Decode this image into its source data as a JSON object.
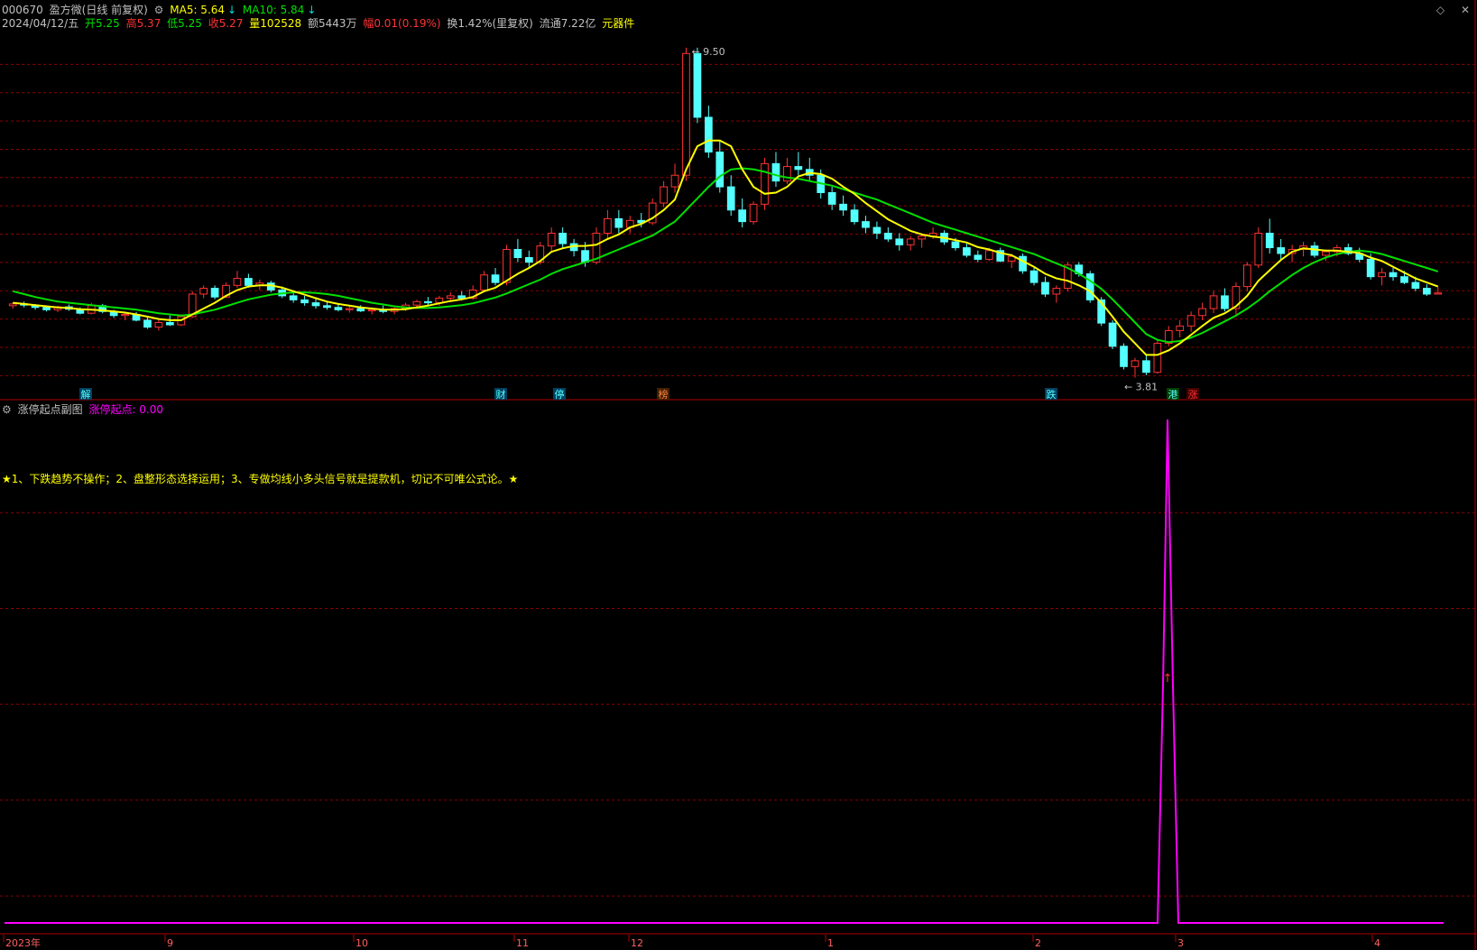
{
  "header": {
    "code": "000670",
    "name": "盈方微(日线 前复权)",
    "ma5_label": "MA5: 5.64",
    "ma10_label": "MA10: 5.84",
    "arrow_down": "↓"
  },
  "quote": {
    "date": "2024/04/12/五",
    "open": "开5.25",
    "high": "高5.37",
    "low": "低5.25",
    "close": "收5.27",
    "volume": "量102528",
    "amount": "额5443万",
    "change_label": "幅0.01",
    "change_pct": "(0.19%)",
    "turnover": "换1.42%(里复权)",
    "float_cap": "流通7.22亿",
    "unit": "元器件"
  },
  "colors": {
    "up": "#ff3232",
    "down": "#54ffff",
    "ma5": "#ffff00",
    "ma10": "#00e000",
    "grid": "#8b0000",
    "indicator": "#ff00ff",
    "text": "#c0c0c0"
  },
  "markers": {
    "high_label": "9.50",
    "low_label": "3.81"
  },
  "events": [
    {
      "label": "解",
      "month": "2023-08"
    },
    {
      "label": "财",
      "month": "2023-10"
    },
    {
      "label": "停",
      "month": "2023-11"
    },
    {
      "label": "榜",
      "month": "2023-11"
    },
    {
      "label": "跌",
      "month": "2024-02"
    },
    {
      "label": "港",
      "month": "2024-03"
    },
    {
      "label": "涨",
      "month": "2024-03"
    }
  ],
  "indicator": {
    "title": "涨停起点副图",
    "value_label": "涨停起点: 0.00",
    "note": "★1、下跌趋势不操作；2、盘整形态选择运用；3、专做均线小多头信号就是提款机，切记不可唯公式论。★"
  },
  "xaxis": {
    "labels": [
      "2023年",
      "9",
      "10",
      "11",
      "12",
      "1",
      "2",
      "3",
      "4"
    ]
  },
  "chart_data": {
    "type": "candlestick",
    "ylim": [
      3.6,
      9.7
    ],
    "series_names": [
      "MA5",
      "MA10"
    ],
    "candles": [
      [
        5.05,
        5.1,
        5.0,
        5.08
      ],
      [
        5.08,
        5.12,
        5.02,
        5.06
      ],
      [
        5.06,
        5.08,
        4.98,
        5.02
      ],
      [
        5.02,
        5.05,
        4.95,
        4.98
      ],
      [
        4.98,
        5.05,
        4.94,
        5.03
      ],
      [
        5.03,
        5.07,
        4.96,
        4.99
      ],
      [
        4.99,
        5.02,
        4.9,
        4.92
      ],
      [
        4.92,
        5.1,
        4.9,
        5.05
      ],
      [
        5.05,
        5.08,
        4.92,
        4.95
      ],
      [
        4.95,
        4.98,
        4.84,
        4.88
      ],
      [
        4.88,
        4.94,
        4.8,
        4.9
      ],
      [
        4.9,
        4.94,
        4.78,
        4.8
      ],
      [
        4.8,
        4.85,
        4.65,
        4.68
      ],
      [
        4.68,
        4.8,
        4.62,
        4.76
      ],
      [
        4.76,
        4.88,
        4.7,
        4.72
      ],
      [
        4.72,
        4.9,
        4.7,
        4.86
      ],
      [
        4.86,
        5.3,
        4.84,
        5.25
      ],
      [
        5.25,
        5.4,
        5.18,
        5.35
      ],
      [
        5.35,
        5.4,
        5.16,
        5.2
      ],
      [
        5.2,
        5.45,
        5.18,
        5.4
      ],
      [
        5.4,
        5.65,
        5.36,
        5.52
      ],
      [
        5.52,
        5.6,
        5.36,
        5.4
      ],
      [
        5.4,
        5.5,
        5.32,
        5.44
      ],
      [
        5.44,
        5.48,
        5.28,
        5.32
      ],
      [
        5.32,
        5.38,
        5.18,
        5.22
      ],
      [
        5.22,
        5.3,
        5.1,
        5.15
      ],
      [
        5.15,
        5.22,
        5.05,
        5.1
      ],
      [
        5.1,
        5.18,
        5.0,
        5.05
      ],
      [
        5.05,
        5.12,
        4.98,
        5.02
      ],
      [
        5.02,
        5.08,
        4.95,
        4.98
      ],
      [
        4.98,
        5.05,
        4.93,
        5.0
      ],
      [
        5.0,
        5.06,
        4.94,
        4.96
      ],
      [
        4.96,
        5.02,
        4.9,
        4.98
      ],
      [
        4.98,
        5.05,
        4.92,
        4.95
      ],
      [
        4.95,
        5.02,
        4.9,
        5.0
      ],
      [
        5.0,
        5.1,
        4.96,
        5.06
      ],
      [
        5.06,
        5.15,
        5.02,
        5.12
      ],
      [
        5.12,
        5.2,
        5.06,
        5.1
      ],
      [
        5.1,
        5.22,
        5.05,
        5.18
      ],
      [
        5.18,
        5.28,
        5.12,
        5.22
      ],
      [
        5.22,
        5.3,
        5.14,
        5.18
      ],
      [
        5.18,
        5.4,
        5.15,
        5.32
      ],
      [
        5.32,
        5.65,
        5.28,
        5.58
      ],
      [
        5.58,
        5.7,
        5.4,
        5.45
      ],
      [
        5.45,
        6.1,
        5.4,
        6.02
      ],
      [
        6.02,
        6.2,
        5.8,
        5.88
      ],
      [
        5.88,
        6.0,
        5.72,
        5.8
      ],
      [
        5.8,
        6.15,
        5.76,
        6.08
      ],
      [
        6.08,
        6.4,
        6.0,
        6.3
      ],
      [
        6.3,
        6.4,
        6.05,
        6.12
      ],
      [
        6.12,
        6.2,
        5.9,
        6.0
      ],
      [
        6.0,
        6.15,
        5.72,
        5.8
      ],
      [
        5.8,
        6.4,
        5.76,
        6.3
      ],
      [
        6.3,
        6.7,
        6.2,
        6.55
      ],
      [
        6.55,
        6.7,
        6.3,
        6.4
      ],
      [
        6.4,
        6.6,
        6.3,
        6.52
      ],
      [
        6.52,
        6.65,
        6.4,
        6.48
      ],
      [
        6.48,
        6.9,
        6.44,
        6.82
      ],
      [
        6.82,
        7.2,
        6.75,
        7.1
      ],
      [
        7.1,
        7.5,
        7.0,
        7.3
      ],
      [
        7.3,
        9.5,
        7.2,
        9.4
      ],
      [
        9.4,
        9.5,
        8.2,
        8.3
      ],
      [
        8.3,
        8.5,
        7.6,
        7.7
      ],
      [
        7.7,
        7.9,
        7.0,
        7.1
      ],
      [
        7.1,
        7.3,
        6.6,
        6.7
      ],
      [
        6.7,
        6.9,
        6.4,
        6.5
      ],
      [
        6.5,
        6.85,
        6.45,
        6.8
      ],
      [
        6.8,
        7.6,
        6.7,
        7.5
      ],
      [
        7.5,
        7.7,
        7.1,
        7.2
      ],
      [
        7.2,
        7.6,
        7.15,
        7.45
      ],
      [
        7.45,
        7.7,
        7.3,
        7.4
      ],
      [
        7.4,
        7.6,
        7.2,
        7.3
      ],
      [
        7.3,
        7.4,
        6.9,
        7.0
      ],
      [
        7.0,
        7.1,
        6.7,
        6.8
      ],
      [
        6.8,
        6.95,
        6.6,
        6.7
      ],
      [
        6.7,
        6.8,
        6.45,
        6.5
      ],
      [
        6.5,
        6.6,
        6.3,
        6.4
      ],
      [
        6.4,
        6.5,
        6.2,
        6.3
      ],
      [
        6.3,
        6.4,
        6.15,
        6.2
      ],
      [
        6.2,
        6.3,
        6.0,
        6.1
      ],
      [
        6.1,
        6.25,
        6.0,
        6.2
      ],
      [
        6.2,
        6.3,
        6.05,
        6.25
      ],
      [
        6.25,
        6.4,
        6.2,
        6.3
      ],
      [
        6.3,
        6.35,
        6.1,
        6.15
      ],
      [
        6.15,
        6.22,
        6.0,
        6.05
      ],
      [
        6.05,
        6.12,
        5.88,
        5.92
      ],
      [
        5.92,
        6.0,
        5.8,
        5.85
      ],
      [
        5.85,
        6.05,
        5.82,
        6.0
      ],
      [
        6.0,
        6.05,
        5.8,
        5.82
      ],
      [
        5.82,
        5.95,
        5.7,
        5.9
      ],
      [
        5.9,
        5.95,
        5.6,
        5.65
      ],
      [
        5.65,
        5.7,
        5.4,
        5.45
      ],
      [
        5.45,
        5.55,
        5.2,
        5.25
      ],
      [
        5.25,
        5.4,
        5.1,
        5.35
      ],
      [
        5.35,
        5.8,
        5.3,
        5.75
      ],
      [
        5.75,
        5.8,
        5.55,
        5.6
      ],
      [
        5.6,
        5.65,
        5.1,
        5.15
      ],
      [
        5.15,
        5.2,
        4.7,
        4.75
      ],
      [
        4.75,
        4.8,
        4.3,
        4.35
      ],
      [
        4.35,
        4.4,
        3.95,
        4.0
      ],
      [
        4.0,
        4.15,
        3.81,
        4.1
      ],
      [
        4.1,
        4.2,
        3.85,
        3.9
      ],
      [
        3.9,
        4.45,
        3.88,
        4.4
      ],
      [
        4.4,
        4.7,
        4.35,
        4.62
      ],
      [
        4.62,
        4.8,
        4.5,
        4.7
      ],
      [
        4.7,
        4.95,
        4.6,
        4.88
      ],
      [
        4.88,
        5.1,
        4.8,
        5.0
      ],
      [
        5.0,
        5.3,
        4.92,
        5.22
      ],
      [
        5.22,
        5.35,
        4.95,
        5.0
      ],
      [
        5.0,
        5.45,
        4.9,
        5.38
      ],
      [
        5.38,
        5.8,
        5.3,
        5.75
      ],
      [
        5.75,
        6.4,
        5.7,
        6.3
      ],
      [
        6.3,
        6.55,
        5.95,
        6.05
      ],
      [
        6.05,
        6.2,
        5.85,
        5.95
      ],
      [
        5.95,
        6.1,
        5.8,
        6.02
      ],
      [
        6.02,
        6.15,
        5.9,
        6.08
      ],
      [
        6.08,
        6.15,
        5.88,
        5.92
      ],
      [
        5.92,
        6.02,
        5.82,
        5.98
      ],
      [
        5.98,
        6.1,
        5.9,
        6.05
      ],
      [
        6.05,
        6.12,
        5.92,
        5.95
      ],
      [
        5.95,
        6.05,
        5.8,
        5.85
      ],
      [
        5.85,
        5.95,
        5.5,
        5.55
      ],
      [
        5.55,
        5.7,
        5.4,
        5.62
      ],
      [
        5.62,
        5.7,
        5.48,
        5.55
      ],
      [
        5.55,
        5.65,
        5.42,
        5.45
      ],
      [
        5.45,
        5.55,
        5.3,
        5.35
      ],
      [
        5.35,
        5.42,
        5.22,
        5.25
      ],
      [
        5.25,
        5.37,
        5.25,
        5.27
      ]
    ],
    "ma5": [
      5.1,
      5.08,
      5.06,
      5.04,
      5.02,
      5.01,
      4.99,
      4.98,
      4.97,
      4.95,
      4.93,
      4.9,
      4.86,
      4.82,
      4.8,
      4.8,
      4.9,
      5.0,
      5.1,
      5.22,
      5.32,
      5.38,
      5.4,
      5.4,
      5.36,
      5.3,
      5.24,
      5.18,
      5.12,
      5.08,
      5.05,
      5.02,
      5.0,
      4.98,
      4.98,
      4.99,
      5.02,
      5.05,
      5.09,
      5.13,
      5.16,
      5.2,
      5.3,
      5.36,
      5.48,
      5.6,
      5.7,
      5.82,
      5.98,
      6.04,
      6.08,
      6.08,
      6.1,
      6.2,
      6.28,
      6.4,
      6.46,
      6.56,
      6.7,
      6.88,
      7.4,
      7.8,
      7.9,
      7.9,
      7.8,
      7.4,
      7.1,
      6.98,
      7.0,
      7.1,
      7.28,
      7.34,
      7.32,
      7.24,
      7.1,
      6.98,
      6.82,
      6.68,
      6.54,
      6.44,
      6.34,
      6.28,
      6.24,
      6.22,
      6.18,
      6.14,
      6.06,
      6.02,
      5.96,
      5.92,
      5.82,
      5.72,
      5.6,
      5.52,
      5.48,
      5.4,
      5.3,
      5.1,
      4.86,
      4.6,
      4.4,
      4.2,
      4.2,
      4.28,
      4.4,
      4.55,
      4.7,
      4.84,
      4.92,
      5.04,
      5.22,
      5.48,
      5.66,
      5.84,
      5.98,
      6.04,
      6.02,
      6.0,
      6.0,
      5.98,
      5.96,
      5.88,
      5.82,
      5.72,
      5.62,
      5.52,
      5.45,
      5.38
    ],
    "ma10": [
      5.3,
      5.25,
      5.2,
      5.16,
      5.12,
      5.1,
      5.08,
      5.06,
      5.04,
      5.02,
      5.0,
      4.98,
      4.95,
      4.92,
      4.9,
      4.88,
      4.9,
      4.94,
      4.98,
      5.04,
      5.1,
      5.16,
      5.2,
      5.24,
      5.26,
      5.28,
      5.28,
      5.27,
      5.25,
      5.22,
      5.18,
      5.14,
      5.1,
      5.07,
      5.04,
      5.02,
      5.01,
      5.01,
      5.02,
      5.04,
      5.06,
      5.09,
      5.14,
      5.19,
      5.26,
      5.34,
      5.42,
      5.5,
      5.6,
      5.68,
      5.74,
      5.8,
      5.86,
      5.94,
      6.02,
      6.1,
      6.18,
      6.26,
      6.38,
      6.5,
      6.7,
      6.9,
      7.1,
      7.28,
      7.4,
      7.42,
      7.4,
      7.36,
      7.3,
      7.26,
      7.24,
      7.2,
      7.16,
      7.12,
      7.06,
      7.0,
      6.94,
      6.88,
      6.8,
      6.72,
      6.64,
      6.56,
      6.48,
      6.42,
      6.36,
      6.3,
      6.24,
      6.18,
      6.12,
      6.06,
      6.0,
      5.94,
      5.86,
      5.78,
      5.7,
      5.6,
      5.48,
      5.34,
      5.16,
      4.96,
      4.76,
      4.56,
      4.46,
      4.42,
      4.44,
      4.5,
      4.58,
      4.68,
      4.78,
      4.88,
      5.0,
      5.14,
      5.3,
      5.44,
      5.58,
      5.7,
      5.8,
      5.88,
      5.94,
      5.98,
      6.0,
      5.98,
      5.94,
      5.88,
      5.82,
      5.76,
      5.7,
      5.64
    ],
    "indicator_values": {
      "spike_value": 1,
      "baseline": 0
    }
  }
}
